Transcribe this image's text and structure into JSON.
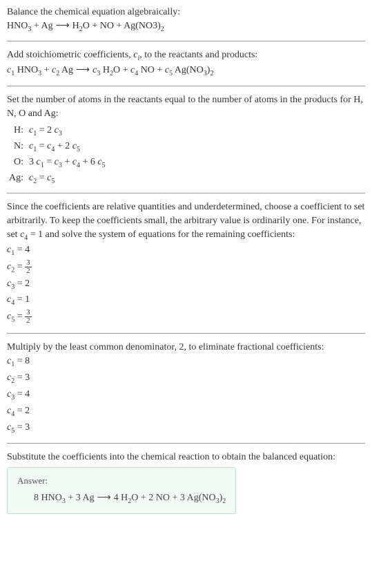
{
  "title": "Balance the chemical equation algebraically:",
  "eq_initial": "HNO₃ + Ag ⟶ H₂O + NO + Ag(NO3)₂",
  "step1_text": "Add stoichiometric coefficients, cᵢ, to the reactants and products:",
  "eq_coeff": "c₁ HNO₃ + c₂ Ag ⟶ c₃ H₂O + c₄ NO + c₅ Ag(NO₃)₂",
  "step2_text": "Set the number of atoms in the reactants equal to the number of atoms in the products for H, N, O and Ag:",
  "atoms": [
    {
      "el": "H:",
      "eq": "c₁ = 2 c₃"
    },
    {
      "el": "N:",
      "eq": "c₁ = c₄ + 2 c₅"
    },
    {
      "el": "O:",
      "eq": "3 c₁ = c₃ + c₄ + 6 c₅"
    },
    {
      "el": "Ag:",
      "eq": "c₂ = c₅"
    }
  ],
  "step3_text": "Since the coefficients are relative quantities and underdetermined, choose a coefficient to set arbitrarily. To keep the coefficients small, the arbitrary value is ordinarily one. For instance, set c₄ = 1 and solve the system of equations for the remaining coefficients:",
  "coeffs1": {
    "c1": "c₁ = 4",
    "c2_pre": "c₂ = ",
    "c2_num": "3",
    "c2_den": "2",
    "c3": "c₃ = 2",
    "c4": "c₄ = 1",
    "c5_pre": "c₅ = ",
    "c5_num": "3",
    "c5_den": "2"
  },
  "step4_text": "Multiply by the least common denominator, 2, to eliminate fractional coefficients:",
  "coeffs2": [
    "c₁ = 8",
    "c₂ = 3",
    "c₃ = 4",
    "c₄ = 2",
    "c₅ = 3"
  ],
  "step5_text": "Substitute the coefficients into the chemical reaction to obtain the balanced equation:",
  "answer_label": "Answer:",
  "answer_eq": "8 HNO₃ + 3 Ag ⟶ 4 H₂O + 2 NO + 3 Ag(NO₃)₂"
}
